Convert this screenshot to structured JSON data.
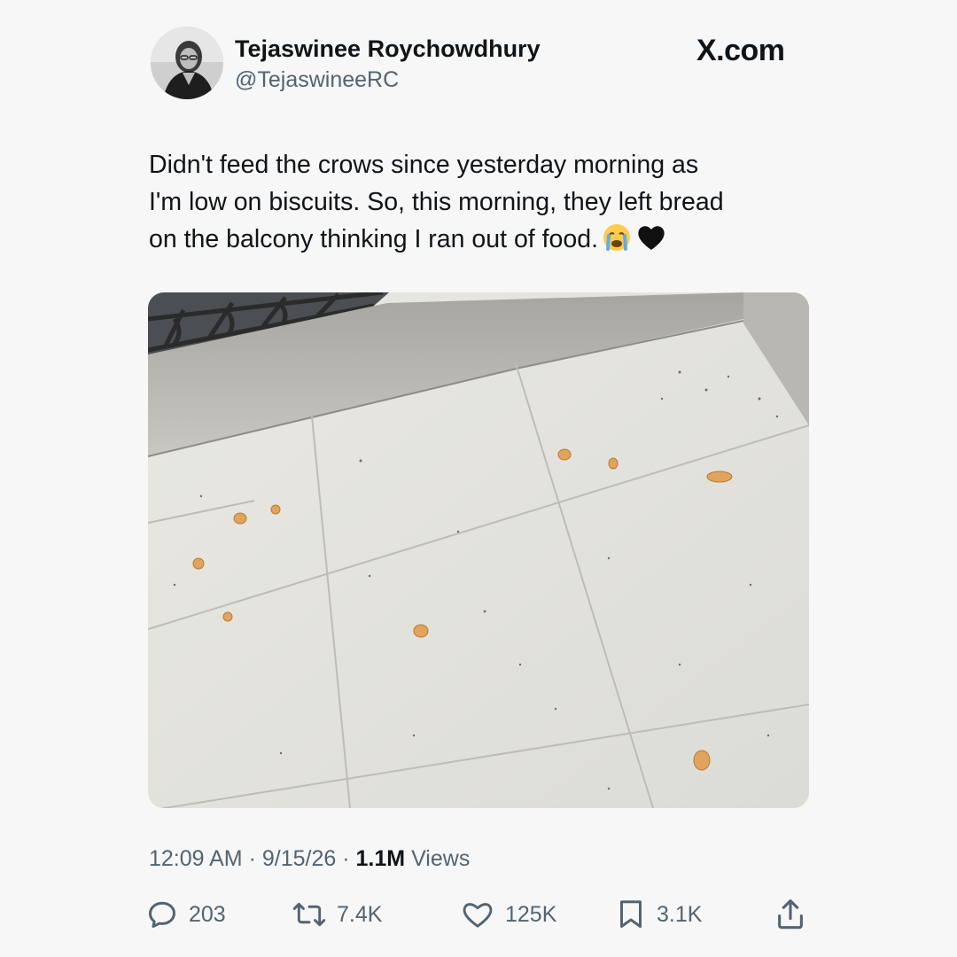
{
  "header": {
    "display_name": "Tejaswinee Roychowdhury",
    "handle": "@TejaswineeRC",
    "site_label": "X.com"
  },
  "tweet": {
    "text_lines": [
      "Didn't feed the crows since yesterday morning as",
      "I'm low on biscuits. So, this morning, they left bread",
      "on the balcony thinking I ran out of food."
    ],
    "emojis": [
      "loudly-crying-face",
      "black-heart"
    ]
  },
  "meta": {
    "time": "12:09 AM",
    "sep1": "·",
    "date": "9/15/26",
    "sep2": "·",
    "views_count": "1.1M",
    "views_label": "Views"
  },
  "actions": {
    "replies": "203",
    "reposts": "7.4K",
    "likes": "125K",
    "bookmarks": "3.1K"
  },
  "colors": {
    "text": "#0f1419",
    "secondary": "#536471",
    "background": "#f7f7f7"
  }
}
